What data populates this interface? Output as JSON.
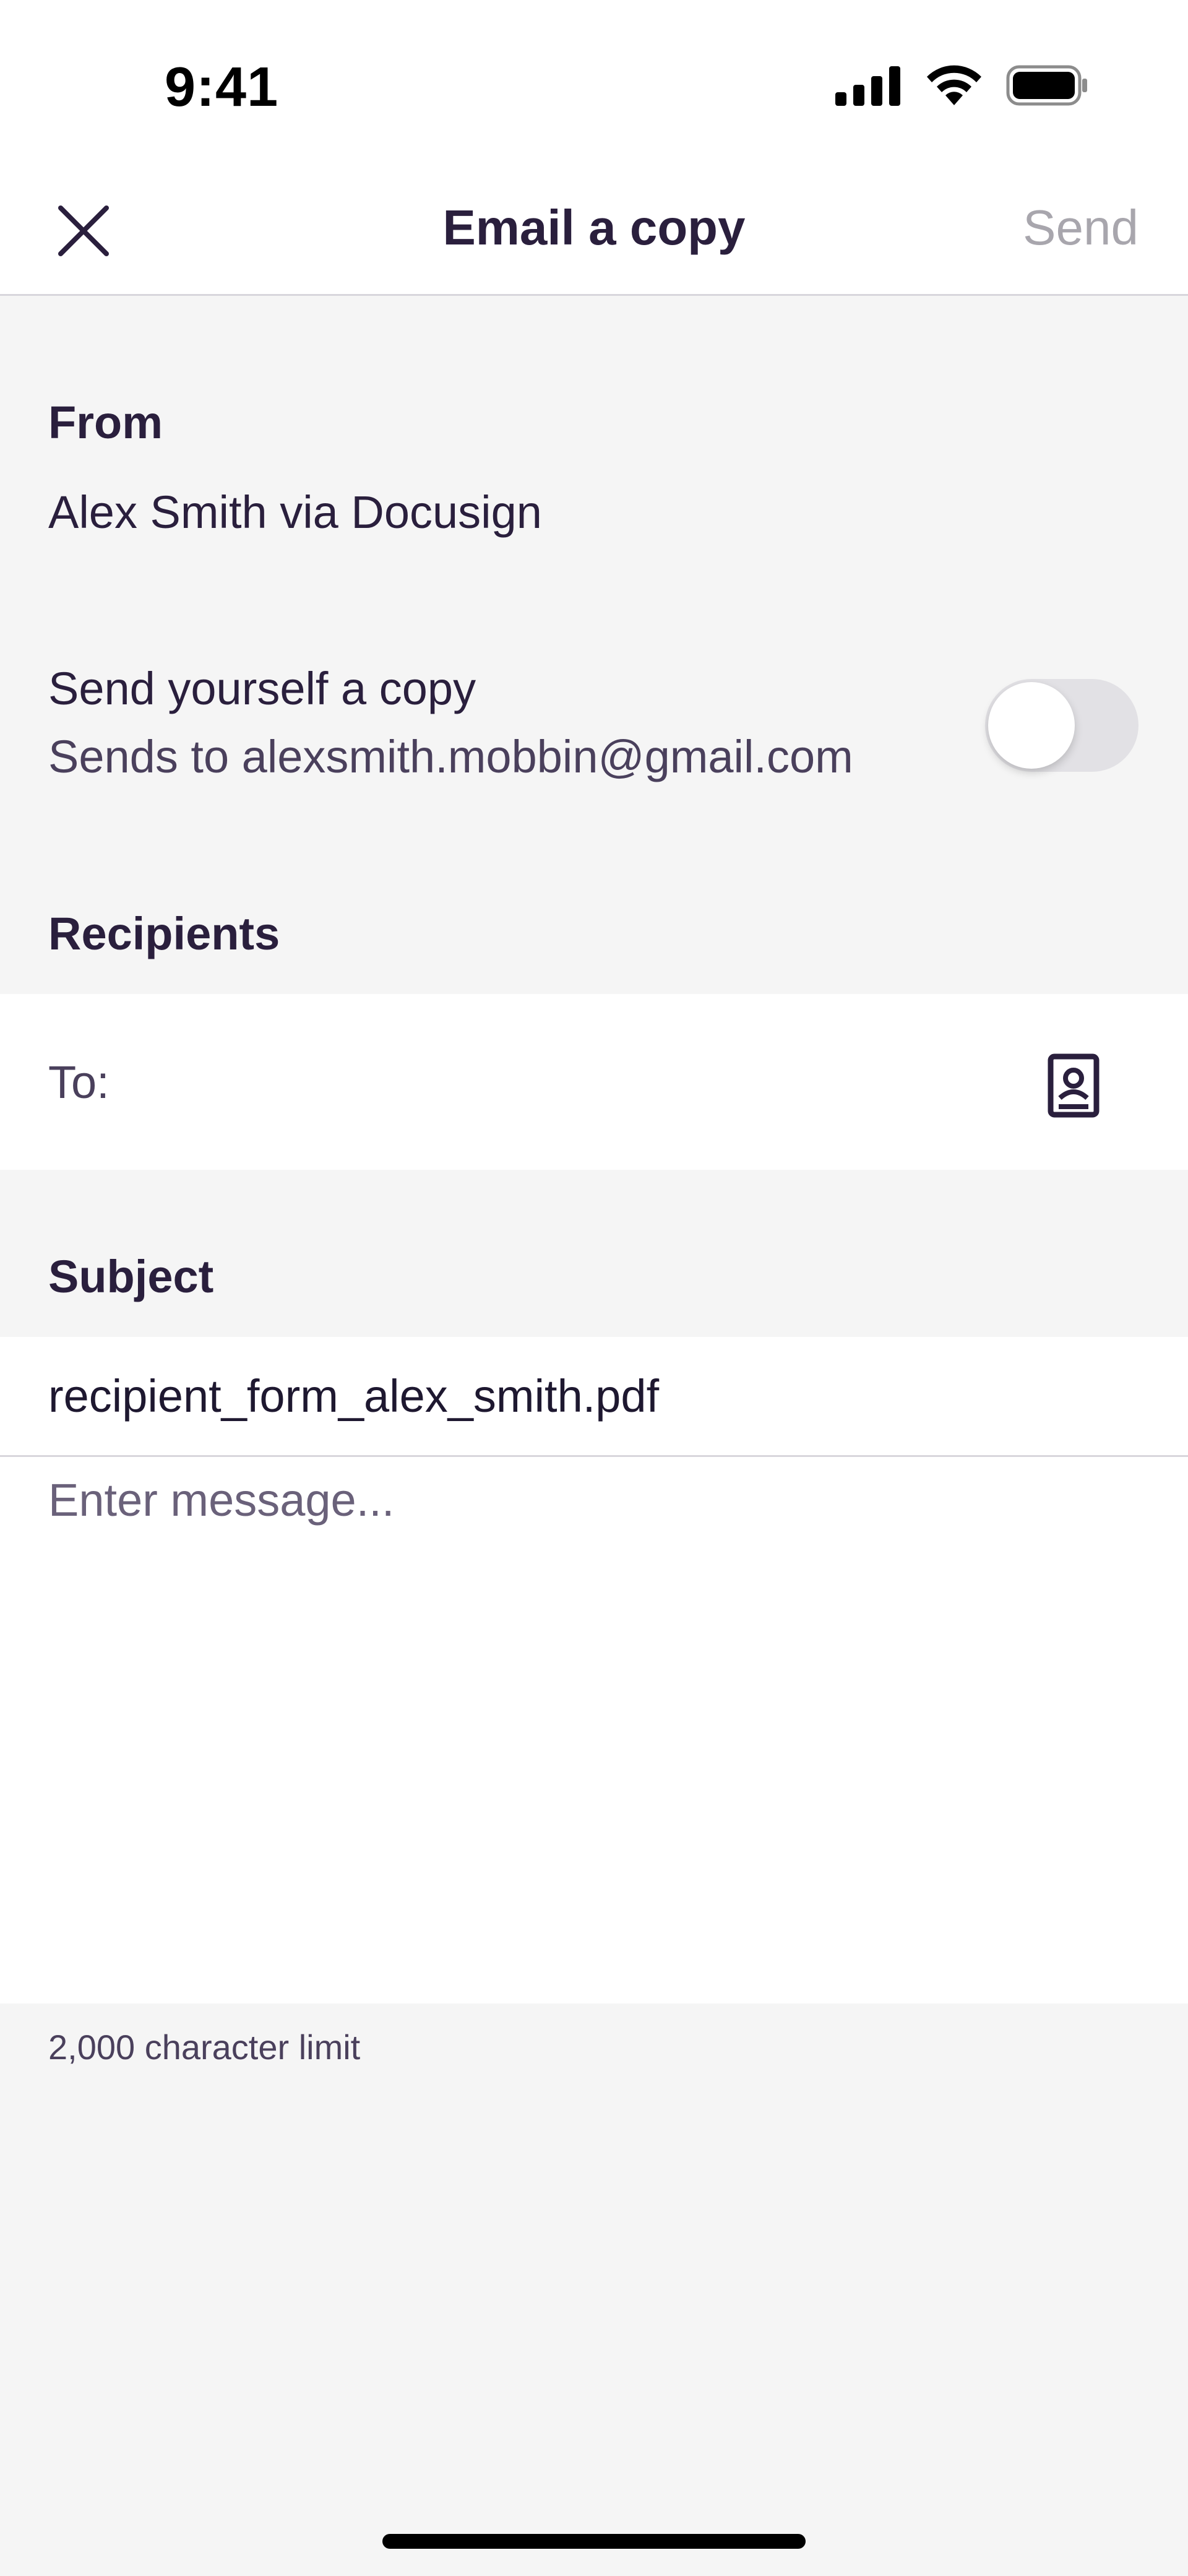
{
  "status_bar": {
    "time": "9:41"
  },
  "nav": {
    "title": "Email a copy",
    "send_label": "Send"
  },
  "from": {
    "label": "From",
    "value": "Alex Smith via Docusign"
  },
  "self_copy": {
    "label": "Send yourself a copy",
    "detail": "Sends to alexsmith.mobbin@gmail.com",
    "enabled": false
  },
  "recipients": {
    "label": "Recipients",
    "to_label": "To:"
  },
  "subject": {
    "label": "Subject",
    "value": "recipient_form_alex_smith.pdf"
  },
  "message": {
    "placeholder": "Enter message...",
    "limit_text": "2,000 character limit"
  },
  "colors": {
    "primary_text": "#2a1f3d",
    "secondary_text": "#4a405c",
    "disabled_text": "#a8a6ad",
    "background": "#f5f5f5",
    "surface": "#ffffff",
    "toggle_off": "#e2e1e5"
  }
}
